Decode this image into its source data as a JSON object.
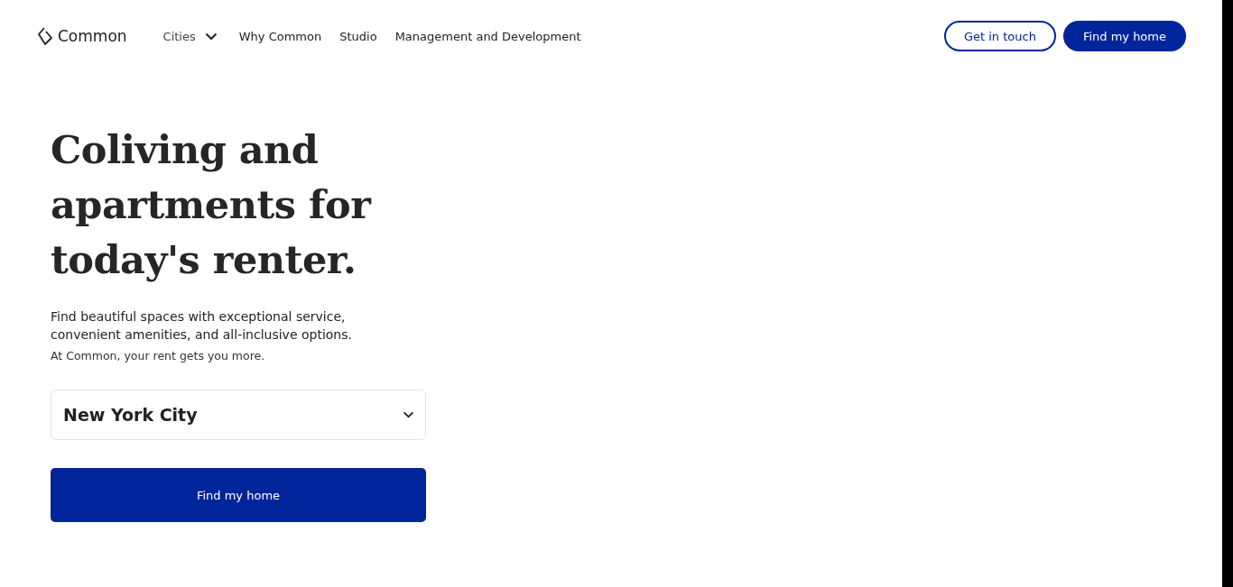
{
  "header": {
    "logo": "Common",
    "nav": [
      {
        "label": "Cities",
        "kind": "dropdown"
      },
      {
        "label": "Why Common",
        "kind": "link"
      },
      {
        "label": "Studio",
        "kind": "link"
      },
      {
        "label": "Management and Development",
        "kind": "link"
      }
    ],
    "buttons": [
      {
        "label": "Get in touch",
        "kind": "outline"
      },
      {
        "label": "Find my home",
        "kind": "filled"
      }
    ]
  },
  "hero": {
    "title": "Coliving and apartments for today's renter.",
    "lead": "Find beautiful spaces with exceptional service, convenient amenities, and all-inclusive options.",
    "note": "At Common, your rent gets you more.",
    "city_select": {
      "value": "New York City"
    },
    "submit": "Find my home"
  }
}
